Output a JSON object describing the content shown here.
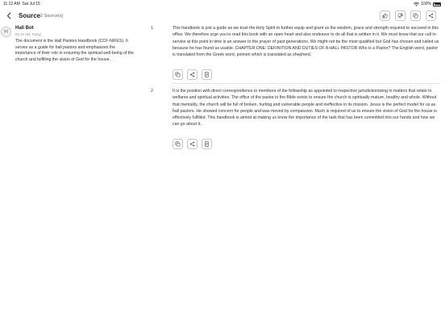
{
  "status_bar": {
    "time": "11:12 AM",
    "date": "Sat Jul 15",
    "battery": "100%"
  },
  "header": {
    "title": "Source",
    "subtitle": "2 Source(s)",
    "buttons": [
      "thumbs-up-icon",
      "thumbs-down-icon",
      "copy-icon",
      "share-icon"
    ]
  },
  "message": {
    "avatar_initial": "H",
    "bot_name": "Hall Bot",
    "timestamp": "05:18 AM, Today",
    "text": "The document is the Hall Pastors Handbook (CCF-NIFES). It serves as a guide for hall pastors and emphasizes the importance of their role in ensuring the spiritual well-being of the church and fulfilling the vision of God for the house."
  },
  "sources": [
    {
      "number": "1",
      "text": "This handbook is just a guide as we trust the Holy Spirit  to further equip and grant us the wisdom, grace and strength required to succeed in this office.  We therefore urge you to read this book with an open heart and  also endeavor to do all that is written in it.  We must know that  our call to service at this point in time is an answer to the prayer  of past generations. We might not be the most qualified but God  has chosen and called us because he has found us usable. CHAPTER ONE:  DEFINITION AND DUTIES OF A HALL PASTOR    Who is a Pastor?  The English word, pastor is translated from the Greek word,  poimen which is translated as shepherd."
    },
    {
      "number": "2",
      "text": "It is the position with direct correspondence to members of the  fellowship as appointed to respective jurisdiction/wing in matters  that relate to welfares and spiritual activities.  The office of the pastor in the Bible exists to ensure the church  is spiritually mature, healthy and whole. Without that mentality,  the church will be full of broken, hurting and vulnerable people  and ineffective in its mission. Jesus is the perfect model for us as  hall pastors. He showed concern for people and was moved by  compassion. Much is required of us to ensure the vision of God  for the house is effectively fulfilled.   This handbook is aimed at making us know the importance of the  task that has been committed into our hands and how we can go  about it."
    }
  ],
  "action_icons": [
    "copy-icon",
    "share-icon",
    "document-icon"
  ]
}
